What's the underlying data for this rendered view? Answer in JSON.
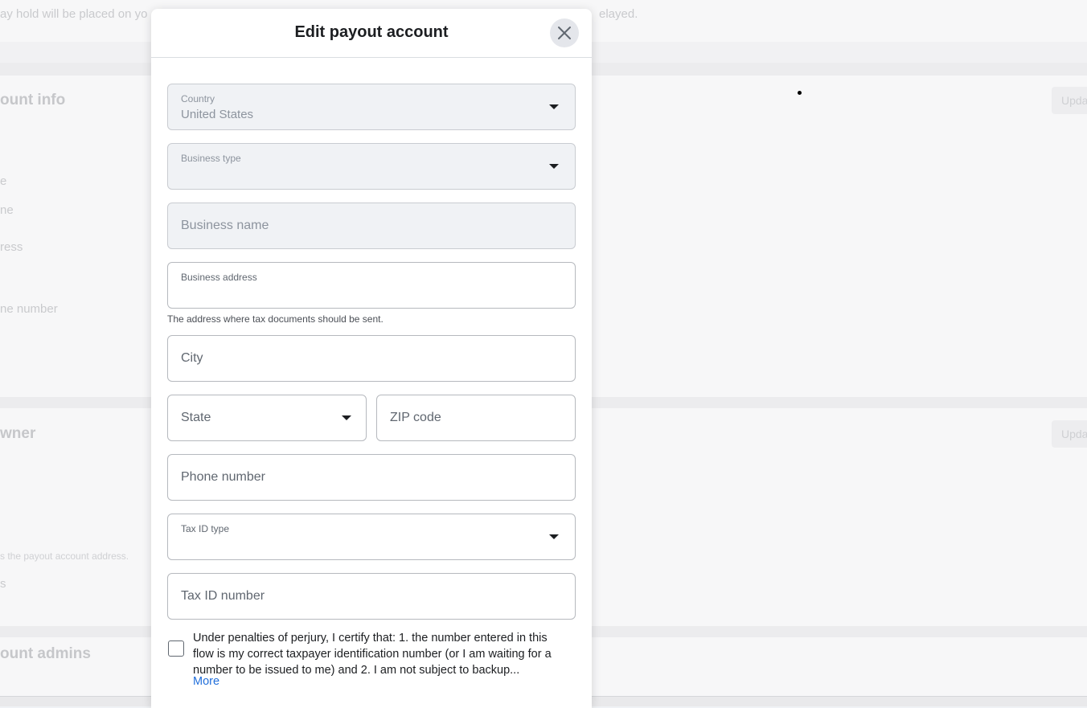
{
  "background": {
    "top_notice": "ay hold will be placed on yo",
    "top_notice_right": "elayed.",
    "section_account_info": "ount info",
    "row_labels": [
      "e",
      "ne",
      "ress",
      "ne number"
    ],
    "section_owner": "wner",
    "owner_helper": "s the payout account address.",
    "owner_row": "s",
    "section_admins": "ount admins",
    "update_label": "Upda"
  },
  "modal": {
    "title": "Edit payout account",
    "close_icon": "close-icon",
    "country": {
      "label": "Country",
      "value": "United States"
    },
    "business_type": {
      "label": "Business type"
    },
    "business_name": {
      "placeholder": "Business name"
    },
    "business_address": {
      "label": "Business address",
      "helper": "The address where tax documents should be sent."
    },
    "city": {
      "placeholder": "City"
    },
    "state": {
      "placeholder": "State"
    },
    "zip": {
      "placeholder": "ZIP code"
    },
    "phone": {
      "placeholder": "Phone number"
    },
    "tax_id_type": {
      "label": "Tax ID type"
    },
    "tax_id_number": {
      "placeholder": "Tax ID number"
    },
    "certification": {
      "text": "Under penalties of perjury, I certify that: 1. the number entered in this flow is my correct taxpayer identification number (or I am waiting for a number to be issued to me) and 2. I am not subject to backup...",
      "more": "More",
      "checked": false
    }
  },
  "colors": {
    "link": "#216fdb",
    "disabled_field": "#f0f2f5"
  }
}
